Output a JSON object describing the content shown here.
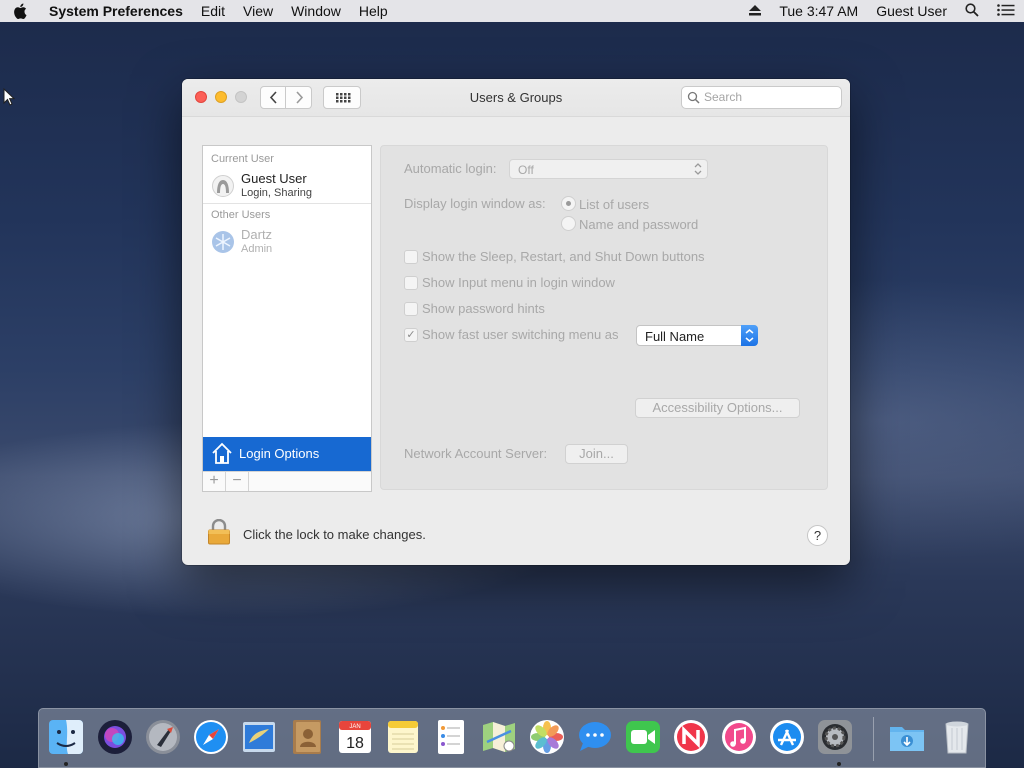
{
  "menubar": {
    "app_name": "System Preferences",
    "menus": [
      "Edit",
      "View",
      "Window",
      "Help"
    ],
    "clock": "Tue 3:47 AM",
    "user": "Guest User"
  },
  "window": {
    "title": "Users & Groups",
    "search_placeholder": "Search"
  },
  "sidebar": {
    "current_user_header": "Current User",
    "current_user": {
      "name": "Guest User",
      "role": "Login, Sharing"
    },
    "other_users_header": "Other Users",
    "other_user": {
      "name": "Dartz",
      "role": "Admin"
    },
    "login_options": "Login Options",
    "add": "+",
    "remove": "−"
  },
  "panel": {
    "automatic_login_label": "Automatic login:",
    "automatic_login_value": "Off",
    "display_label": "Display login window as:",
    "radio_list": "List of users",
    "radio_name": "Name and password",
    "cb_sleep": "Show the Sleep, Restart, and Shut Down buttons",
    "cb_input": "Show Input menu in login window",
    "cb_hints": "Show password hints",
    "cb_fast": "Show fast user switching menu as",
    "fast_value": "Full Name",
    "accessibility_button": "Accessibility Options...",
    "network_label": "Network Account Server:",
    "join_button": "Join...",
    "checkbox_checked_mark": "✓"
  },
  "footer": {
    "lock_text": "Click the lock to make changes.",
    "help": "?"
  },
  "dock": {
    "calendar_month": "JAN",
    "calendar_day": "18",
    "items": [
      "finder-icon",
      "siri-icon",
      "launchpad-icon",
      "safari-icon",
      "mail-icon",
      "contacts-icon",
      "calendar-icon",
      "notes-icon",
      "reminders-icon",
      "maps-icon",
      "photos-icon",
      "messages-icon",
      "facetime-icon",
      "news-icon",
      "music-icon",
      "app-store-icon",
      "system-preferences-icon",
      "downloads-folder-icon",
      "trash-icon"
    ]
  },
  "colors": {
    "selection_blue": "#1769d2",
    "red": "#fc5f57",
    "yellow": "#fdbc2e"
  }
}
